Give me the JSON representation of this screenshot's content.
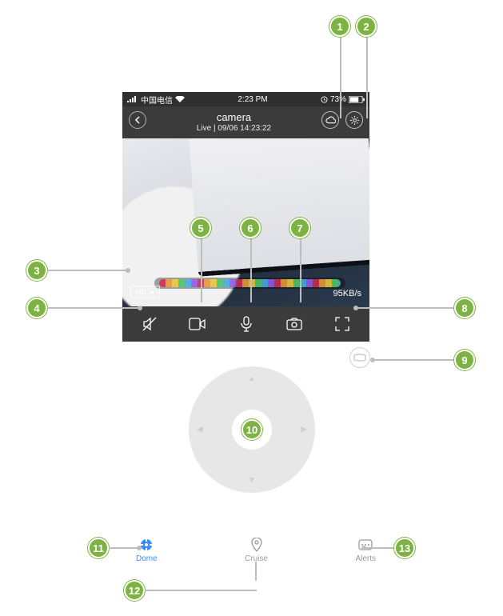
{
  "statusbar": {
    "carrier": "中国电信",
    "time": "2:23 PM",
    "battery": "73%"
  },
  "header": {
    "title": "camera",
    "subtitle": "Live | 09/06 14:23:22"
  },
  "video": {
    "quality": "HD",
    "rate": "95KB/s"
  },
  "tabs": {
    "dome": "Dome",
    "cruise": "Cruise",
    "alerts": "Alerts"
  },
  "callouts": {
    "c1": "1",
    "c2": "2",
    "c3": "3",
    "c4": "4",
    "c5": "5",
    "c6": "6",
    "c7": "7",
    "c8": "8",
    "c9": "9",
    "c10": "10",
    "c11": "11",
    "c12": "12",
    "c13": "13"
  }
}
